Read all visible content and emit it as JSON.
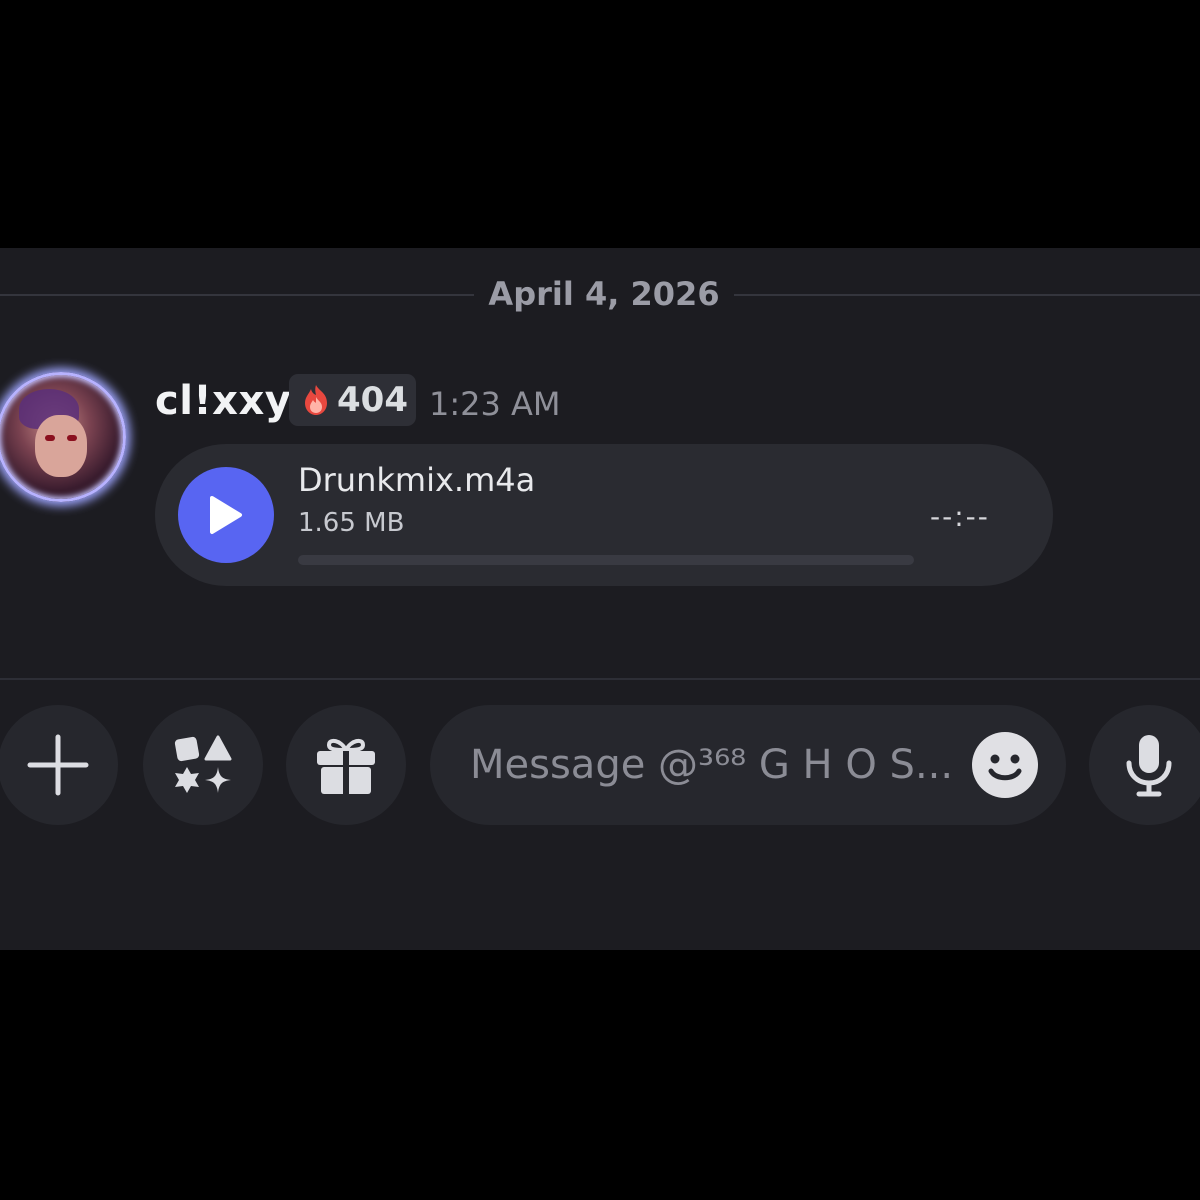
{
  "chat": {
    "date_divider": "April 4, 2026",
    "message": {
      "username": "cl!xxy",
      "tag_count": "404",
      "timestamp": "1:23 AM",
      "attachment": {
        "file_name": "Drunkmix.m4a",
        "file_size": "1.65 MB",
        "duration": "--:--",
        "progress": 0
      }
    }
  },
  "composer": {
    "placeholder": "Message @³⁶⁸ G H O S...",
    "icons": [
      "plus-icon",
      "apps-icon",
      "gift-icon",
      "emoji-icon",
      "microphone-icon"
    ]
  },
  "colors": {
    "accent": "#5865f2",
    "background": "#1c1c21",
    "surface": "#2a2b31"
  }
}
